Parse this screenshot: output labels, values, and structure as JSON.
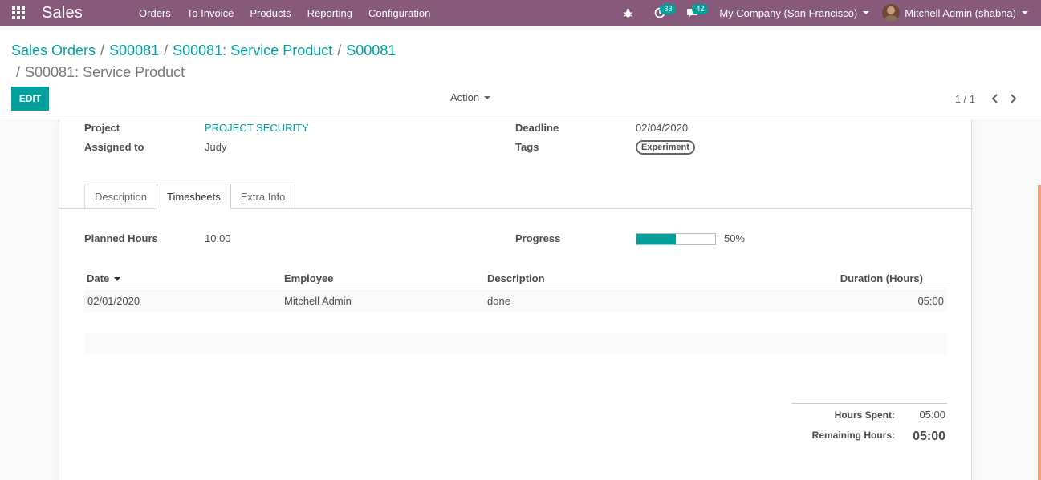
{
  "navbar": {
    "app_name": "Sales",
    "menu": [
      "Orders",
      "To Invoice",
      "Products",
      "Reporting",
      "Configuration"
    ],
    "activity_count": "33",
    "message_count": "42",
    "company": "My Company (San Francisco)",
    "user": "Mitchell Admin (shabna)",
    "color": "#875a7b"
  },
  "breadcrumb": {
    "items": [
      "Sales Orders",
      "S00081",
      "S00081: Service Product",
      "S00081"
    ],
    "active": "S00081: Service Product"
  },
  "controls": {
    "edit_label": "EDIT",
    "action_label": "Action",
    "pager": "1 / 1"
  },
  "task": {
    "project_label": "Project",
    "project_value": "PROJECT SECURITY",
    "assigned_label": "Assigned to",
    "assigned_value": "Judy",
    "deadline_label": "Deadline",
    "deadline_value": "02/04/2020",
    "tags_label": "Tags",
    "tag": "Experiment"
  },
  "tabs": [
    "Description",
    "Timesheets",
    "Extra Info"
  ],
  "active_tab": "Timesheets",
  "timesheets": {
    "planned_label": "Planned Hours",
    "planned_value": "10:00",
    "progress_label": "Progress",
    "progress_text": "50%",
    "progress": 0.5,
    "columns": [
      "Date",
      "Employee",
      "Description",
      "Duration (Hours)"
    ],
    "rows": [
      {
        "date": "02/01/2020",
        "employee": "Mitchell Admin",
        "description": "done",
        "duration": "05:00"
      }
    ],
    "hours_spent_label": "Hours Spent:",
    "hours_spent_value": "05:00",
    "remaining_label": "Remaining Hours:",
    "remaining_value": "05:00"
  },
  "accent_color": "#00a09d"
}
